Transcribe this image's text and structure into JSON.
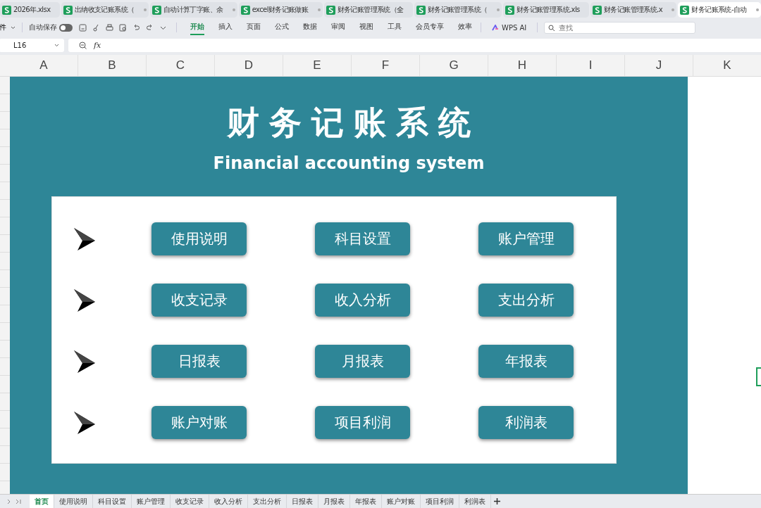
{
  "file_tabs": [
    {
      "label": "2026年.xlsx",
      "selected": false,
      "closable": false
    },
    {
      "label": "出纳收支记账系统（",
      "selected": false,
      "closable": true
    },
    {
      "label": "自动计算丁字账、余",
      "selected": false,
      "closable": true
    },
    {
      "label": "excel财务记账做账",
      "selected": false,
      "closable": true
    },
    {
      "label": "财务记账管理系统（全",
      "selected": false,
      "closable": false
    },
    {
      "label": "财务记账管理系统（",
      "selected": false,
      "closable": true
    },
    {
      "label": "财务记账管理系统.xls",
      "selected": false,
      "closable": false
    },
    {
      "label": "财务记账管理系统.x",
      "selected": false,
      "closable": true
    },
    {
      "label": "财务记账系统-自动",
      "selected": true,
      "closable": true
    }
  ],
  "toolbar": {
    "file_menu": "件",
    "autosave": {
      "label": "自动保存",
      "on": false
    },
    "ribbon_tabs": [
      {
        "label": "开始",
        "selected": true
      },
      {
        "label": "插入",
        "selected": false
      },
      {
        "label": "页面",
        "selected": false
      },
      {
        "label": "公式",
        "selected": false
      },
      {
        "label": "数据",
        "selected": false
      },
      {
        "label": "审阅",
        "selected": false
      },
      {
        "label": "视图",
        "selected": false
      },
      {
        "label": "工具",
        "selected": false
      },
      {
        "label": "会员专享",
        "selected": false
      },
      {
        "label": "效率",
        "selected": false
      }
    ],
    "ai_button": "WPS AI",
    "search": {
      "placeholder": "查找"
    }
  },
  "formula_bar": {
    "cell_ref": "L16",
    "fx": "fx"
  },
  "columns": [
    "A",
    "B",
    "C",
    "D",
    "E",
    "F",
    "G",
    "H",
    "I",
    "J",
    "K"
  ],
  "dashboard": {
    "title": "财务记账系统",
    "subtitle": "Financial accounting system",
    "rows": [
      {
        "buttons": [
          "使用说明",
          "科目设置",
          "账户管理"
        ]
      },
      {
        "buttons": [
          "收支记录",
          "收入分析",
          "支出分析"
        ]
      },
      {
        "buttons": [
          "日报表",
          "月报表",
          "年报表"
        ]
      },
      {
        "buttons": [
          "账户对账",
          "项目利润",
          "利润表"
        ]
      }
    ]
  },
  "sheet_tabs": [
    {
      "label": "首页",
      "selected": true
    },
    {
      "label": "使用说明",
      "selected": false
    },
    {
      "label": "科目设置",
      "selected": false
    },
    {
      "label": "账户管理",
      "selected": false
    },
    {
      "label": "收支记录",
      "selected": false
    },
    {
      "label": "收入分析",
      "selected": false
    },
    {
      "label": "支出分析",
      "selected": false
    },
    {
      "label": "日报表",
      "selected": false
    },
    {
      "label": "月报表",
      "selected": false
    },
    {
      "label": "年报表",
      "selected": false
    },
    {
      "label": "账户对账",
      "selected": false
    },
    {
      "label": "项目利润",
      "selected": false
    },
    {
      "label": "利润表",
      "selected": false
    }
  ]
}
